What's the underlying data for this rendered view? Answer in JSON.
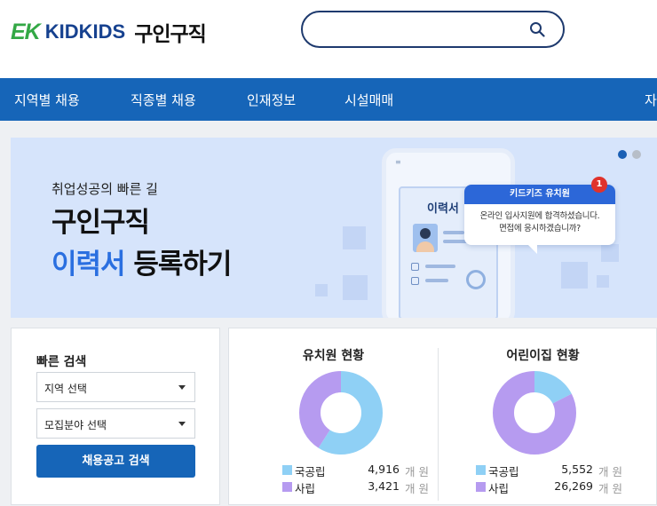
{
  "header": {
    "logo_ek": "EK",
    "logo_kidkids": "KIDKIDS",
    "logo_title": "구인구직",
    "search": {
      "value": "",
      "placeholder": ""
    }
  },
  "nav": {
    "items": [
      "지역별 채용",
      "직종별 채용",
      "인재정보",
      "시설매매",
      "자"
    ]
  },
  "banner": {
    "subtitle": "취업성공의 빠른 길",
    "title1": "구인구직",
    "title2_highlight": "이력서",
    "title2_rest": " 등록하기",
    "resume_label": "이력서",
    "bubble_sender": "키드키즈 유치원",
    "bubble_line1": "온라인 입사지원에 합격하셨습니다.",
    "bubble_line2": "면접에 응시하겠습니까?",
    "badge_count": "1",
    "slide_count": 2,
    "active_slide": 1
  },
  "quick_search": {
    "title": "빠른 검색",
    "region_select": "지역 선택",
    "field_select": "모집분야 선택",
    "button": "채용공고 검색"
  },
  "status": {
    "panels": [
      {
        "title": "유치원 현황",
        "items": [
          {
            "label": "국공립",
            "value": 4916,
            "display": "4,916",
            "unit": "개 원",
            "color": "#8fd0f5"
          },
          {
            "label": "사립",
            "value": 3421,
            "display": "3,421",
            "unit": "개 원",
            "color": "#b69bf0"
          }
        ]
      },
      {
        "title": "어린이집 현황",
        "items": [
          {
            "label": "국공립",
            "value": 5552,
            "display": "5,552",
            "unit": "개 원",
            "color": "#8fd0f5"
          },
          {
            "label": "사립",
            "value": 26269,
            "display": "26,269",
            "unit": "개 원",
            "color": "#b69bf0"
          }
        ]
      }
    ]
  }
}
